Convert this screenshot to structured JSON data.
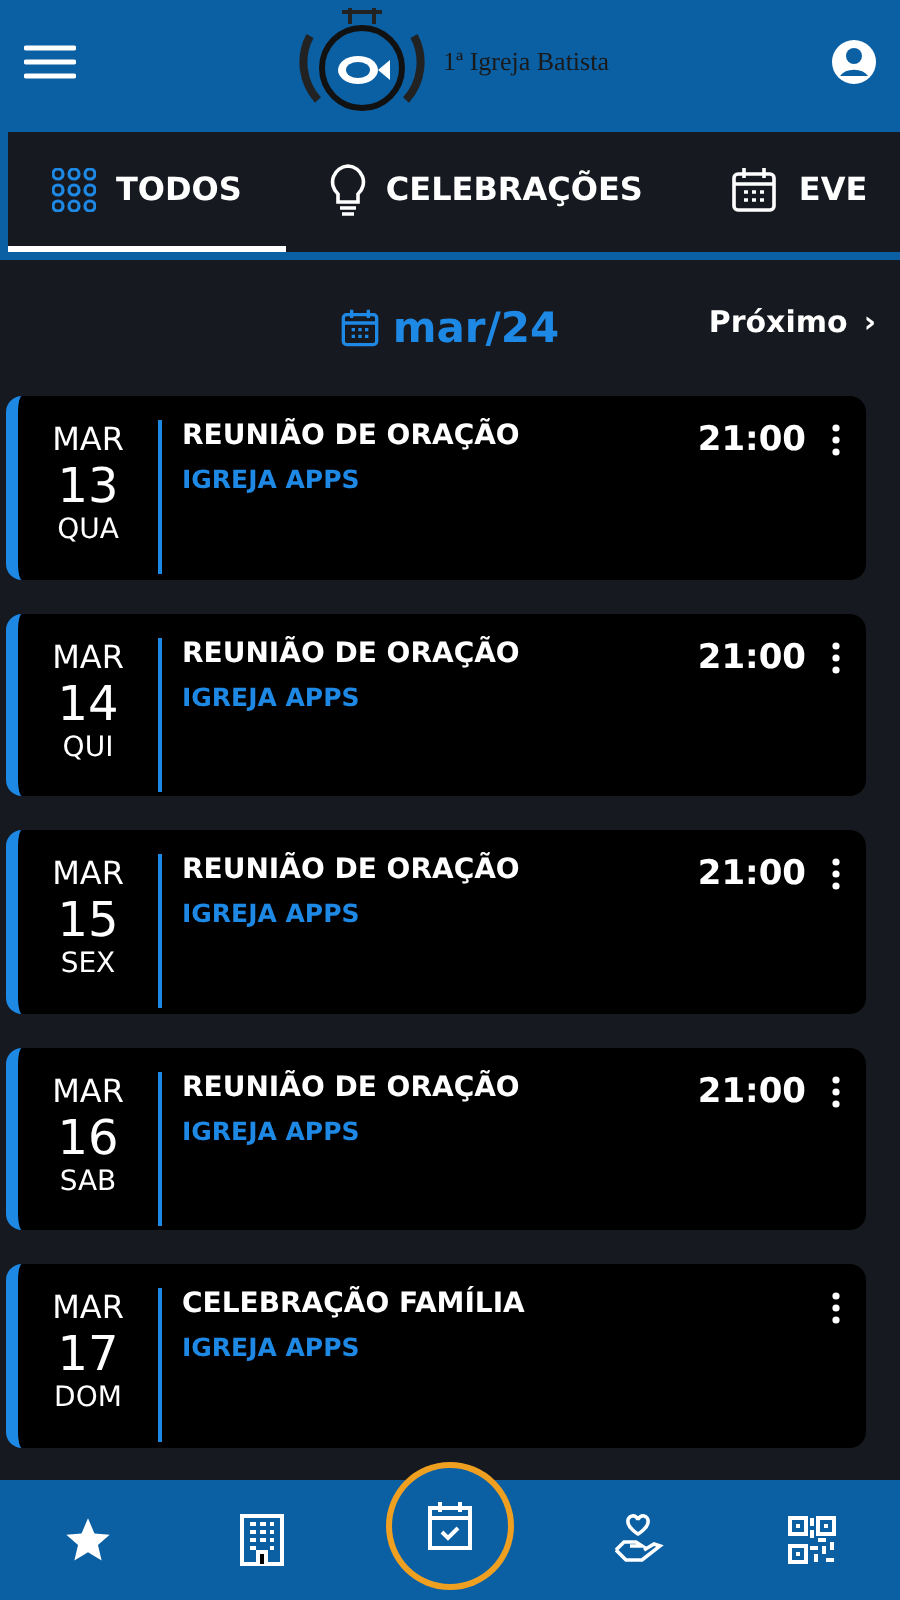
{
  "header": {
    "logo_text": "1ª Igreja Batista"
  },
  "tabs": [
    {
      "label": "TODOS",
      "selected": true
    },
    {
      "label": "CELEBRAÇÕES",
      "selected": false
    },
    {
      "label": "EVE",
      "selected": false
    }
  ],
  "month": {
    "label": "mar/24",
    "next": "Próximo",
    "next_icon": "›"
  },
  "events": [
    {
      "month": "MAR",
      "day": "13",
      "weekday": "QUA",
      "title": "REUNIÃO DE ORAÇÃO",
      "organizer": "IGREJA APPS",
      "time": "21:00"
    },
    {
      "month": "MAR",
      "day": "14",
      "weekday": "QUI",
      "title": "REUNIÃO DE ORAÇÃO",
      "organizer": "IGREJA APPS",
      "time": "21:00"
    },
    {
      "month": "MAR",
      "day": "15",
      "weekday": "SEX",
      "title": "REUNIÃO DE ORAÇÃO",
      "organizer": "IGREJA APPS",
      "time": "21:00"
    },
    {
      "month": "MAR",
      "day": "16",
      "weekday": "SAB",
      "title": "REUNIÃO DE ORAÇÃO",
      "organizer": "IGREJA APPS",
      "time": "21:00"
    },
    {
      "month": "MAR",
      "day": "17",
      "weekday": "DOM",
      "title": "CELEBRAÇÃO FAMÍLIA",
      "organizer": "IGREJA APPS"
    }
  ],
  "bottom_nav": [
    {
      "selected": false
    },
    {
      "selected": false
    },
    {
      "selected": true
    },
    {
      "selected": false
    },
    {
      "selected": false
    }
  ]
}
